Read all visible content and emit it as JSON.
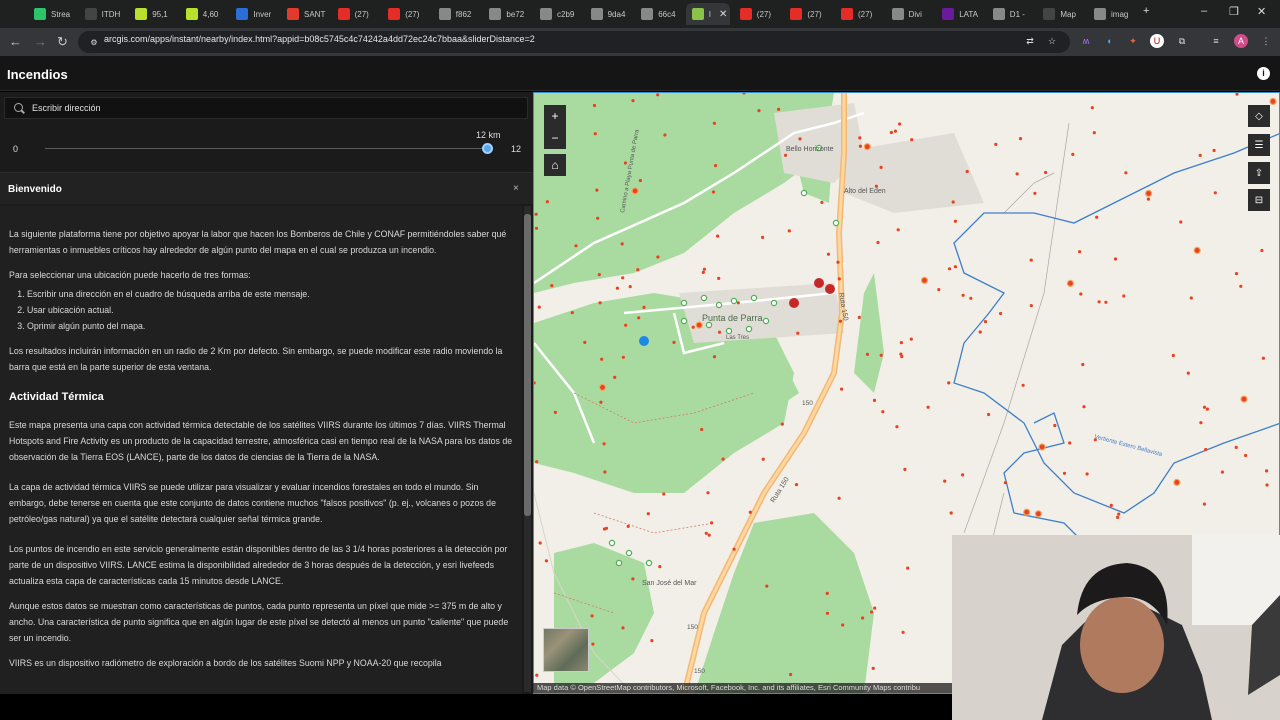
{
  "browser": {
    "tabs": [
      {
        "label": "Strea",
        "icon": "twitch-icon",
        "color": "#2cc36b"
      },
      {
        "label": "ITDH",
        "icon": "tt-icon",
        "color": "#444444"
      },
      {
        "label": "95,1",
        "icon": "chart-icon",
        "color": "#b8e02c"
      },
      {
        "label": "4,60",
        "icon": "chart-icon",
        "color": "#b8e02c"
      },
      {
        "label": "Inver",
        "icon": "arrow-icon",
        "color": "#2b6fd6"
      },
      {
        "label": "SANT",
        "icon": "bolt-icon",
        "color": "#e23b2e"
      },
      {
        "label": "(27)",
        "icon": "youtube-icon",
        "color": "#e52d27"
      },
      {
        "label": "(27)",
        "icon": "youtube-icon",
        "color": "#e52d27"
      },
      {
        "label": "f862",
        "icon": "globe-icon",
        "color": "#888888"
      },
      {
        "label": "be72",
        "icon": "globe-icon",
        "color": "#888888"
      },
      {
        "label": "c2b9",
        "icon": "globe-icon",
        "color": "#888888"
      },
      {
        "label": "9da4",
        "icon": "globe-icon",
        "color": "#888888"
      },
      {
        "label": "66c4",
        "icon": "globe-icon",
        "color": "#888888"
      },
      {
        "label": "I",
        "icon": "arcgis-icon",
        "color": "#8bc34a",
        "active": true
      },
      {
        "label": "(27)",
        "icon": "youtube-icon",
        "color": "#e52d27"
      },
      {
        "label": "(27)",
        "icon": "youtube-icon",
        "color": "#e52d27"
      },
      {
        "label": "(27)",
        "icon": "youtube-icon",
        "color": "#e52d27"
      },
      {
        "label": "Divi",
        "icon": "window-icon",
        "color": "#888888"
      },
      {
        "label": "LATA",
        "icon": "plane-icon",
        "color": "#6a1b9a"
      },
      {
        "label": "D1 -",
        "icon": "globe-icon",
        "color": "#888888"
      },
      {
        "label": "Map",
        "icon": "tt-icon",
        "color": "#444444"
      },
      {
        "label": "imag",
        "icon": "globe-icon",
        "color": "#888888"
      }
    ],
    "url": "arcgis.com/apps/instant/nearby/index.html?appid=b08c5745c4c74242a4dd72ec24c7bbaa&sliderDistance=2"
  },
  "app": {
    "title": "Incendios"
  },
  "search": {
    "placeholder": "Escribir dirección"
  },
  "slider": {
    "min": "0",
    "max": "12",
    "value_label": "12 km",
    "value": 12
  },
  "welcome": {
    "title": "Bienvenido",
    "close": "×",
    "p1": "La siguiente plataforma tiene por objetivo apoyar la labor que hacen los Bomberos de Chile y CONAF permitiéndoles saber qué herramientas o inmuebles críticos hay alrededor de algún punto del mapa en el cual se produzca un incendio.",
    "p2": "Para seleccionar una ubicación puede hacerlo de tres formas:",
    "list": [
      "Escribir una dirección en el cuadro de búsqueda arriba de este mensaje.",
      "Usar ubicación actual.",
      "Oprimir algún punto del mapa."
    ],
    "p3": "Los resultados incluirán información en un radio de 2 Km por defecto. Sin embargo, se puede modificar este radio moviendo la barra que está en la parte superior de esta ventana.",
    "h2": "Actividad Térmica",
    "p4": "Este mapa presenta una capa con actividad térmica detectable de los satélites VIIRS durante los últimos 7 días. VIIRS Thermal Hotspots and Fire Activity es un producto de la capacidad terrestre, atmosférica casi en tiempo real de la NASA para los datos de observación de la Tierra EOS (LANCE), parte de los datos de ciencias de la Tierra de la NASA.",
    "p5": "La capa de actividad térmica VIIRS se puede utilizar para visualizar y evaluar incendios forestales en todo el mundo. Sin embargo, debe tenerse en cuenta que este conjunto de datos contiene muchos \"falsos positivos\" (p. ej., volcanes o pozos de petróleo/gas natural) ya que el satélite detectará cualquier señal térmica grande.",
    "p6": "Los puntos de incendio en este servicio generalmente están disponibles dentro de las 3 1/4 horas posteriores a la detección por parte de un dispositivo VIIRS. LANCE estima la disponibilidad alrededor de 3 horas después de la detección, y esri livefeeds actualiza esta capa de características cada 15 minutos desde LANCE.",
    "p7": "Aunque estos datos se muestran como características de puntos, cada punto representa un píxel que mide >= 375 m de alto y ancho. Una característica de punto significa que en algún lugar de este píxel se detectó al menos un punto \"caliente\" que puede ser un incendio.",
    "p8": "VIIRS es un dispositivo radiómetro de exploración a bordo de los satélites Suomi NPP y NOAA-20 que recopila"
  },
  "map": {
    "labels": {
      "bello_horizonte": "Bello Horizonte",
      "alto_eden": "Alto del Eden",
      "punta_de_parra": "Punta de Parra",
      "las_tres": "Las Tres",
      "san_jose": "San José del Mar",
      "ruta_150a": "Ruta 150",
      "ruta_150b": "Ruta 150",
      "r150_1": "150",
      "r150_2": "150",
      "r150_3": "150",
      "camino": "Camino a Playa Punta de Parra",
      "vertiente": "Vertiente Estero Bellavista"
    },
    "attribution": "Map data © OpenStreetMap contributors, Microsoft, Facebook, Inc. and its affiliates, Esri Community Maps contribu",
    "controls": {
      "zoom_in": "+",
      "zoom_out": "−",
      "home": "⌂"
    },
    "colors": {
      "fire": "#e8431f",
      "green": "#8fcf8a",
      "road": "#f5b872",
      "water": "#3d7fc9"
    }
  }
}
